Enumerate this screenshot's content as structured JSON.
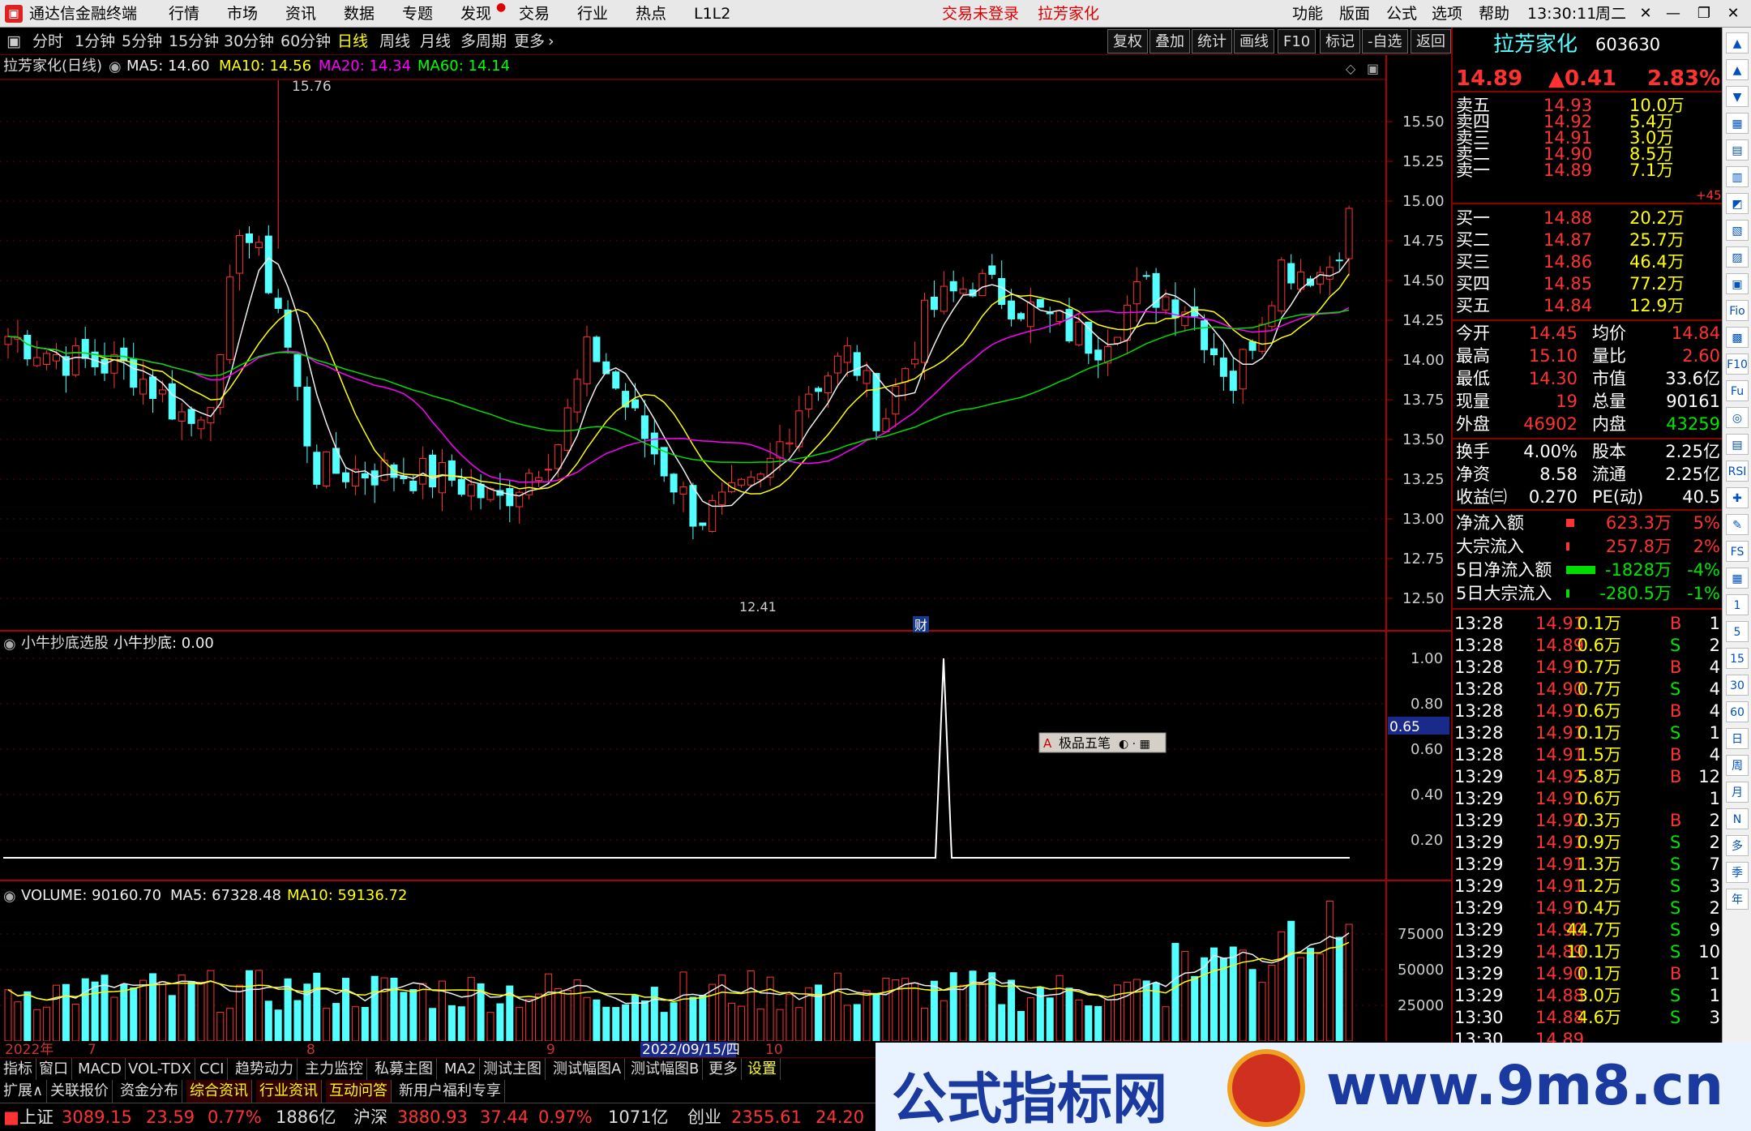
{
  "menubar": {
    "app_title": "通达信金融终端",
    "menus": [
      "行情",
      "市场",
      "资讯",
      "数据",
      "专题",
      "发现",
      "交易",
      "行业",
      "热点",
      "L1L2"
    ],
    "trade_status": "交易未登录",
    "stock_name": "拉芳家化",
    "right_menus": [
      "功能",
      "版面",
      "公式",
      "选项",
      "帮助"
    ],
    "time": "13:30:11",
    "weekday": "周二"
  },
  "periodbar": {
    "periods": [
      "分时",
      "1分钟",
      "5分钟",
      "15分钟",
      "30分钟",
      "60分钟",
      "日线",
      "周线",
      "月线",
      "多周期",
      "更多"
    ],
    "active": "日线",
    "right_buttons": [
      "复权",
      "叠加",
      "统计",
      "画线",
      "F10",
      "标记",
      "-自选",
      "返回"
    ]
  },
  "chart": {
    "main_legend": {
      "title": "拉芳家化(日线)",
      "ma5": "MA5: 14.60",
      "ma10": "MA10: 14.56",
      "ma20": "MA20: 14.34",
      "ma60": "MA60: 14.14"
    },
    "high_label": "15.76",
    "low_label": "12.41",
    "event_marker": "财",
    "price_ticks": [
      "15.50",
      "15.25",
      "15.00",
      "14.75",
      "14.50",
      "14.25",
      "14.00",
      "13.75",
      "13.50",
      "13.25",
      "13.00",
      "12.75",
      "12.50"
    ],
    "ind_legend": {
      "name": "小牛抄底选股",
      "value": "小牛抄底: 0.00"
    },
    "ind_ticks": [
      "1.00",
      "0.80",
      "0.60",
      "0.40",
      "0.20"
    ],
    "ind_cursor": "0.65",
    "vol_legend": {
      "volume": "VOLUME: 90160.70",
      "ma5": "MA5: 67328.48",
      "ma10": "MA10: 59136.72"
    },
    "vol_ticks": [
      "75000",
      "50000",
      "25000"
    ],
    "date_labels": [
      "2022年",
      "7",
      "8",
      "9",
      "2022/09/15/四",
      "10"
    ],
    "overlay_widget": "极品五笔"
  },
  "chart_data": {
    "type": "candlestick",
    "y_range": [
      12.41,
      15.76
    ],
    "ma_values": {
      "MA5": 14.6,
      "MA10": 14.56,
      "MA20": 14.34,
      "MA60": 14.14
    },
    "indicator_signal_peak": 1.0,
    "volume_last": 90160.7
  },
  "quote": {
    "name": "拉芳家化",
    "code": "603630",
    "price": "14.89",
    "change": "▲0.41",
    "pct": "2.83%",
    "asks": [
      [
        "卖五",
        "14.93",
        "10.0万"
      ],
      [
        "卖四",
        "14.92",
        "5.4万"
      ],
      [
        "卖三",
        "14.91",
        "3.0万"
      ],
      [
        "卖二",
        "14.90",
        "8.5万"
      ],
      [
        "卖一",
        "14.89",
        "7.1万"
      ]
    ],
    "ask_extra": "+45",
    "bids": [
      [
        "买一",
        "14.88",
        "20.2万"
      ],
      [
        "买二",
        "14.87",
        "25.7万"
      ],
      [
        "买三",
        "14.86",
        "46.4万"
      ],
      [
        "买四",
        "14.85",
        "77.2万"
      ],
      [
        "买五",
        "14.84",
        "12.9万"
      ]
    ],
    "stats": [
      [
        "今开",
        "14.45",
        "均价",
        "14.84"
      ],
      [
        "最高",
        "15.10",
        "量比",
        "2.60"
      ],
      [
        "最低",
        "14.30",
        "市值",
        "33.6亿"
      ],
      [
        "现量",
        "19",
        "总量",
        "90161"
      ],
      [
        "外盘",
        "46902",
        "内盘",
        "43259"
      ]
    ],
    "stats2": [
      [
        "换手",
        "4.00%",
        "股本",
        "2.25亿"
      ],
      [
        "净资",
        "8.58",
        "流通",
        "2.25亿"
      ],
      [
        "收益㈢",
        "0.270",
        "PE(动)",
        "40.5"
      ]
    ],
    "flows": [
      [
        "净流入额",
        "623.3万",
        "5%"
      ],
      [
        "大宗流入",
        "257.8万",
        "2%"
      ],
      [
        "5日净流入额",
        "-1828万",
        "-4%"
      ],
      [
        "5日大宗流入",
        "-280.5万",
        "-1%"
      ]
    ],
    "ticks": [
      [
        "13:28",
        "14.91",
        "0.1万",
        "B",
        "1"
      ],
      [
        "13:28",
        "14.89",
        "0.6万",
        "S",
        "2"
      ],
      [
        "13:28",
        "14.91",
        "0.7万",
        "B",
        "4"
      ],
      [
        "13:28",
        "14.90",
        "0.7万",
        "S",
        "4"
      ],
      [
        "13:28",
        "14.91",
        "0.6万",
        "B",
        "4"
      ],
      [
        "13:28",
        "14.91",
        "0.1万",
        "S",
        "1"
      ],
      [
        "13:28",
        "14.91",
        "1.5万",
        "B",
        "4"
      ],
      [
        "13:29",
        "14.92",
        "5.8万",
        "B",
        "12"
      ],
      [
        "13:29",
        "14.91",
        "0.6万",
        "",
        "1"
      ],
      [
        "13:29",
        "14.92",
        "0.3万",
        "B",
        "2"
      ],
      [
        "13:29",
        "14.91",
        "0.9万",
        "S",
        "2"
      ],
      [
        "13:29",
        "14.91",
        "1.3万",
        "S",
        "7"
      ],
      [
        "13:29",
        "14.91",
        "1.2万",
        "S",
        "3"
      ],
      [
        "13:29",
        "14.91",
        "0.4万",
        "S",
        "2"
      ],
      [
        "13:29",
        "14.90",
        "44.7万",
        "S",
        "9"
      ],
      [
        "13:29",
        "14.89",
        "10.1万",
        "S",
        "10"
      ],
      [
        "13:29",
        "14.90",
        "0.1万",
        "B",
        "1"
      ],
      [
        "13:29",
        "14.88",
        "3.0万",
        "S",
        "1"
      ],
      [
        "13:30",
        "14.88",
        "4.6万",
        "S",
        "3"
      ],
      [
        "13:30",
        "14.89",
        "",
        "",
        ""
      ]
    ]
  },
  "toolstrip": [
    "▲",
    "▲",
    "▼",
    "▦",
    "▤",
    "▥",
    "◩",
    "▧",
    "▨",
    "▣",
    "Fio",
    "▩",
    "F10",
    "Fu",
    "◎",
    "▤",
    "RSI",
    "✚",
    "✎",
    "FS",
    "▦",
    "1",
    "5",
    "15",
    "30",
    "60",
    "日",
    "周",
    "月",
    "N",
    "多",
    "季",
    "年"
  ],
  "tabs1": [
    "指标",
    "窗口",
    "MACD",
    "VOL-TDX",
    "CCI",
    "趋势动力",
    "主力监控",
    "私募主图",
    "MA2",
    "测试主图",
    "测试幅图A",
    "测试幅图B",
    "更多",
    "设置"
  ],
  "tabs2": [
    "扩展∧",
    "关联报价",
    "资金分布",
    "综合资讯",
    "行业资讯",
    "互动问答",
    "新用户福利专享"
  ],
  "status": {
    "sh_name": "上证",
    "sh_val": "3089.15",
    "sh_chg": "23.59",
    "sh_pct": "0.77%",
    "sh_amt": "1886亿",
    "hs_name": "沪深",
    "hs_val": "3880.93",
    "hs_chg": "37.44",
    "hs_pct": "0.97%",
    "hs_amt": "1071亿",
    "cy_name": "创业",
    "cy_val": "2355.61",
    "cy_chg": "24.20"
  },
  "watermark": {
    "left": "公式指标网",
    "right": "www.9m8.cn"
  }
}
